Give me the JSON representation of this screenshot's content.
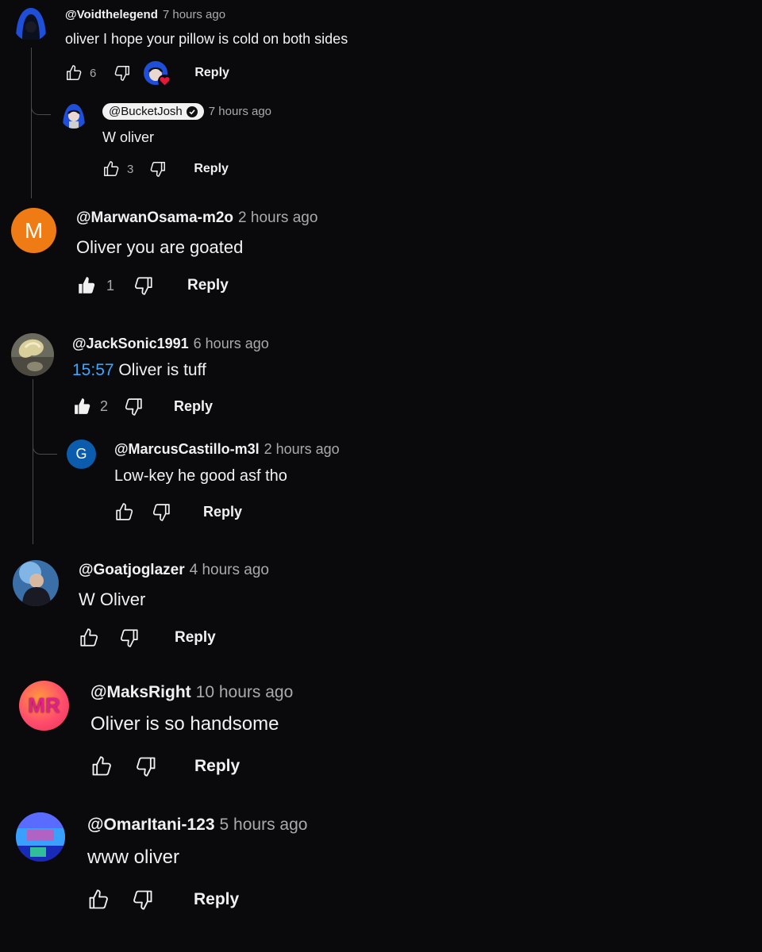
{
  "comments": [
    {
      "handle": "@Voidthelegend",
      "time": "7 hours ago",
      "text": "oliver I hope your pillow is cold on both sides",
      "likes": "6",
      "reply": "Reply"
    },
    {
      "handle": "@BucketJosh",
      "time": "7 hours ago",
      "text": "W oliver",
      "likes": "3",
      "reply": "Reply"
    },
    {
      "handle": "@MarwanOsama-m2o",
      "avatar_letter": "M",
      "avatar_color": "#ef7b14",
      "time": "2 hours ago",
      "text": "Oliver you are goated",
      "likes": "1",
      "reply": "Reply"
    },
    {
      "handle": "@JackSonic1991",
      "time": "6 hours ago",
      "timestamp": "15:57",
      "text": "Oliver is tuff",
      "likes": "2",
      "reply": "Reply"
    },
    {
      "handle": "@MarcusCastillo-m3l",
      "avatar_letter": "G",
      "avatar_color": "#0b5cad",
      "time": "2 hours ago",
      "text": "Low-key he good asf tho",
      "reply": "Reply"
    },
    {
      "handle": "@Goatjoglazer",
      "time": "4 hours ago",
      "text": "W Oliver",
      "reply": "Reply"
    },
    {
      "handle": "@MaksRight",
      "avatar_letter": "MR",
      "time": "10 hours ago",
      "text": "Oliver is so handsome",
      "reply": "Reply"
    },
    {
      "handle": "@OmarItani-123",
      "time": "5 hours ago",
      "text": "www oliver",
      "reply": "Reply"
    }
  ],
  "colors": {
    "background": "#0a0a0d",
    "link": "#3ea6ff",
    "secondary_text": "#aaaaaa",
    "heart": "#e3183a"
  }
}
